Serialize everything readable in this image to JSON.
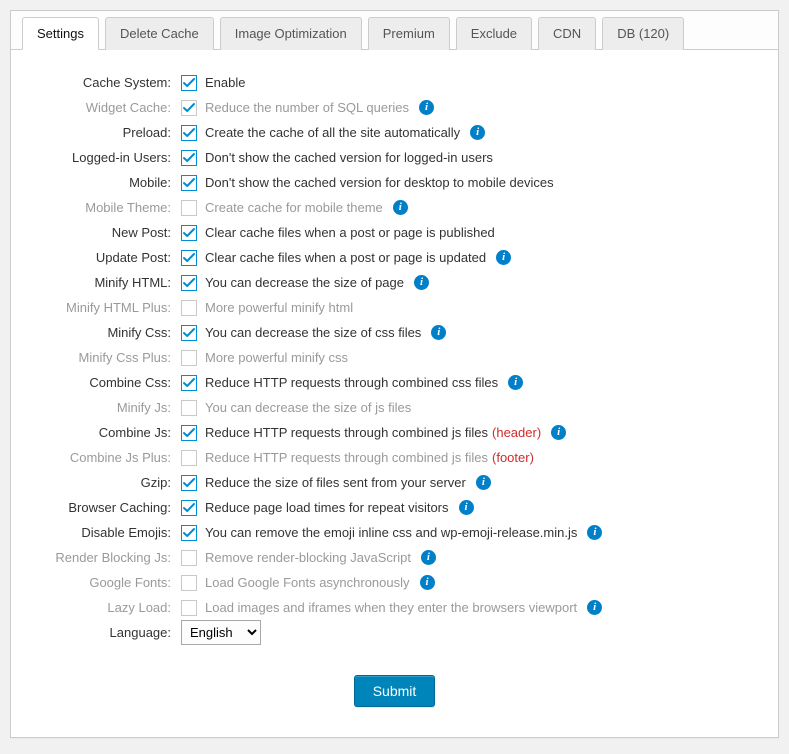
{
  "tabs": [
    {
      "label": "Settings",
      "active": true
    },
    {
      "label": "Delete Cache",
      "active": false
    },
    {
      "label": "Image Optimization",
      "active": false
    },
    {
      "label": "Premium",
      "active": false
    },
    {
      "label": "Exclude",
      "active": false
    },
    {
      "label": "CDN",
      "active": false
    },
    {
      "label": "DB (120)",
      "active": false
    }
  ],
  "options": [
    {
      "label": "Cache System:",
      "desc": "Enable",
      "checked": true,
      "disabled": false,
      "info": false,
      "extra": "",
      "extraColor": ""
    },
    {
      "label": "Widget Cache:",
      "desc": "Reduce the number of SQL queries",
      "checked": true,
      "disabled": true,
      "info": true,
      "extra": "",
      "extraColor": ""
    },
    {
      "label": "Preload:",
      "desc": "Create the cache of all the site automatically",
      "checked": true,
      "disabled": false,
      "info": true,
      "extra": "",
      "extraColor": ""
    },
    {
      "label": "Logged-in Users:",
      "desc": "Don't show the cached version for logged-in users",
      "checked": true,
      "disabled": false,
      "info": false,
      "extra": "",
      "extraColor": ""
    },
    {
      "label": "Mobile:",
      "desc": "Don't show the cached version for desktop to mobile devices",
      "checked": true,
      "disabled": false,
      "info": false,
      "extra": "",
      "extraColor": ""
    },
    {
      "label": "Mobile Theme:",
      "desc": "Create cache for mobile theme",
      "checked": false,
      "disabled": true,
      "info": true,
      "extra": "",
      "extraColor": ""
    },
    {
      "label": "New Post:",
      "desc": "Clear cache files when a post or page is published",
      "checked": true,
      "disabled": false,
      "info": false,
      "extra": "",
      "extraColor": ""
    },
    {
      "label": "Update Post:",
      "desc": "Clear cache files when a post or page is updated",
      "checked": true,
      "disabled": false,
      "info": true,
      "extra": "",
      "extraColor": ""
    },
    {
      "label": "Minify HTML:",
      "desc": "You can decrease the size of page",
      "checked": true,
      "disabled": false,
      "info": true,
      "extra": "",
      "extraColor": ""
    },
    {
      "label": "Minify HTML Plus:",
      "desc": "More powerful minify html",
      "checked": false,
      "disabled": true,
      "info": false,
      "extra": "",
      "extraColor": ""
    },
    {
      "label": "Minify Css:",
      "desc": "You can decrease the size of css files",
      "checked": true,
      "disabled": false,
      "info": true,
      "extra": "",
      "extraColor": ""
    },
    {
      "label": "Minify Css Plus:",
      "desc": "More powerful minify css",
      "checked": false,
      "disabled": true,
      "info": false,
      "extra": "",
      "extraColor": ""
    },
    {
      "label": "Combine Css:",
      "desc": "Reduce HTTP requests through combined css files",
      "checked": true,
      "disabled": false,
      "info": true,
      "extra": "",
      "extraColor": ""
    },
    {
      "label": "Minify Js:",
      "desc": "You can decrease the size of js files",
      "checked": false,
      "disabled": true,
      "info": false,
      "extra": "",
      "extraColor": ""
    },
    {
      "label": "Combine Js:",
      "desc": "Reduce HTTP requests through combined js files",
      "checked": true,
      "disabled": false,
      "info": true,
      "extra": "(header)",
      "extraColor": "red"
    },
    {
      "label": "Combine Js Plus:",
      "desc": "Reduce HTTP requests through combined js files",
      "checked": false,
      "disabled": true,
      "info": false,
      "extra": "(footer)",
      "extraColor": "red"
    },
    {
      "label": "Gzip:",
      "desc": "Reduce the size of files sent from your server",
      "checked": true,
      "disabled": false,
      "info": true,
      "extra": "",
      "extraColor": ""
    },
    {
      "label": "Browser Caching:",
      "desc": "Reduce page load times for repeat visitors",
      "checked": true,
      "disabled": false,
      "info": true,
      "extra": "",
      "extraColor": ""
    },
    {
      "label": "Disable Emojis:",
      "desc": "You can remove the emoji inline css and wp-emoji-release.min.js",
      "checked": true,
      "disabled": false,
      "info": true,
      "extra": "",
      "extraColor": ""
    },
    {
      "label": "Render Blocking Js:",
      "desc": "Remove render-blocking JavaScript",
      "checked": false,
      "disabled": true,
      "info": true,
      "extra": "",
      "extraColor": ""
    },
    {
      "label": "Google Fonts:",
      "desc": "Load Google Fonts asynchronously",
      "checked": false,
      "disabled": true,
      "info": true,
      "extra": "",
      "extraColor": ""
    },
    {
      "label": "Lazy Load:",
      "desc": "Load images and iframes when they enter the browsers viewport",
      "checked": false,
      "disabled": true,
      "info": true,
      "extra": "",
      "extraColor": ""
    }
  ],
  "language": {
    "label": "Language:",
    "value": "English"
  },
  "submit_label": "Submit"
}
